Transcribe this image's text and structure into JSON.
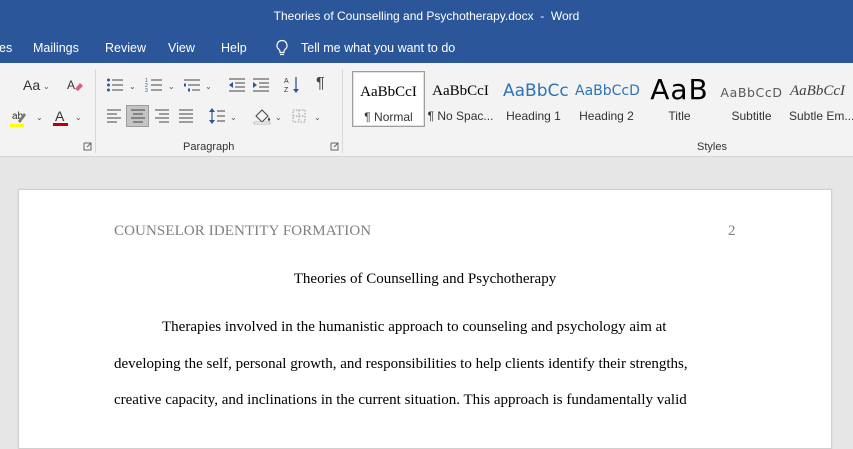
{
  "window": {
    "title": "Theories of Counselling and Psychotherapy.docx  -  Word"
  },
  "menu": {
    "items": [
      "es",
      "Mailings",
      "Review",
      "View",
      "Help"
    ],
    "tell_me": "Tell me what you want to do"
  },
  "ribbon": {
    "font_group": {
      "case_label": "Aa",
      "font_color": "#c00000",
      "highlight_color": "#ffff00"
    },
    "paragraph_group": {
      "label": "Paragraph",
      "pilcrow": "¶"
    },
    "styles_group": {
      "label": "Styles",
      "items": [
        {
          "preview": "AaBbCcI",
          "name": "¶ Normal"
        },
        {
          "preview": "AaBbCcI",
          "name": "¶ No Spac..."
        },
        {
          "preview": "AaBbCc",
          "name": "Heading 1"
        },
        {
          "preview": "AaBbCcD",
          "name": "Heading 2"
        },
        {
          "preview": "AaB",
          "name": "Title"
        },
        {
          "preview": "AaBbCcD",
          "name": "Subtitle"
        },
        {
          "preview": "AaBbCcI",
          "name": "Subtle Em..."
        }
      ]
    }
  },
  "document": {
    "header_left": "COUNSELOR IDENTITY FORMATION",
    "page_number": "2",
    "title": "Theories of Counselling and Psychotherapy",
    "lines": [
      "Therapies involved in the humanistic approach to counseling and psychology aim at",
      "developing the self, personal growth, and responsibilities to help clients identify their strengths,",
      "creative capacity, and inclinations in the current situation. This approach is fundamentally valid"
    ]
  },
  "colors": {
    "accent": "#2b579a"
  }
}
